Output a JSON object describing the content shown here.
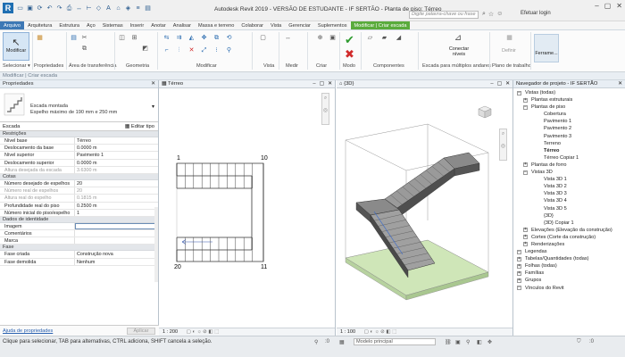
{
  "app": {
    "title": "Autodesk Revit 2019 - VERSÃO DE ESTUDANTE - IF SERTÃO - Planta de piso: Térreo",
    "logo": "R",
    "search_placeholder": "Digite palavra-chave ou frase",
    "user": "Efetuar login",
    "qat_icons": [
      "open-icon",
      "save-icon",
      "sync-icon",
      "undo-icon",
      "redo-icon",
      "print-icon",
      "measure-icon",
      "dimension-icon",
      "tag-icon",
      "text-icon",
      "3d-view-icon",
      "section-icon",
      "thin-lines-icon",
      "close-hidden-icon"
    ]
  },
  "ribbon": {
    "tabs": [
      "Arquivo",
      "Arquitetura",
      "Estrutura",
      "Aço",
      "Sistemas",
      "Inserir",
      "Anotar",
      "Analisar",
      "Massa e terreno",
      "Colaborar",
      "Vista",
      "Gerenciar",
      "Suplementos",
      "Modificar | Criar escada"
    ],
    "active_tab": "Arquivo",
    "context_tab": "Modificar | Criar escada",
    "modify_label": "Modificar",
    "panels": [
      {
        "label": "Selecionar ▾"
      },
      {
        "label": "Propriedades"
      },
      {
        "label": "Área de transferência"
      },
      {
        "label": "Geometria"
      },
      {
        "label": "Modificar"
      },
      {
        "label": "Vista"
      },
      {
        "label": "Medir"
      },
      {
        "label": "Criar"
      },
      {
        "label": "Modo"
      },
      {
        "label": "Componentes"
      },
      {
        "label": "Escada para múltiplos andares"
      },
      {
        "label": "Plano de trabalho"
      }
    ],
    "connect_levels": "Conectar níveis",
    "define_label": "Definir",
    "frame_label": "Ferrame..."
  },
  "options_bar": {
    "text": "Modificar | Criar escada"
  },
  "properties": {
    "title": "Propriedades",
    "type_name_line1": "Escada montada",
    "type_name_line2": "Espelho máximo de 190 mm e 250 mm",
    "family": "Escada",
    "edit_type": "Editar tipo",
    "groups": [
      {
        "name": "Restrições",
        "rows": [
          {
            "k": "Nível base",
            "v": "Térreo",
            "grey": false
          },
          {
            "k": "Deslocamento da base",
            "v": "0.0000 m",
            "grey": false
          },
          {
            "k": "Nível superior",
            "v": "Pavimento 1",
            "grey": false
          },
          {
            "k": "Deslocamento superior",
            "v": "0.0000 m",
            "grey": false
          },
          {
            "k": "Altura desejada da escada",
            "v": "3.6300 m",
            "grey": true
          }
        ]
      },
      {
        "name": "Cotas",
        "rows": [
          {
            "k": "Número desejado de espelhos",
            "v": "20",
            "grey": false
          },
          {
            "k": "Número real de espelhos",
            "v": "20",
            "grey": true
          },
          {
            "k": "Altura real do espelho",
            "v": "0.1815 m",
            "grey": true
          },
          {
            "k": "Profundidade real do piso",
            "v": "0.2500 m",
            "grey": false
          },
          {
            "k": "Número inicial do piso/espelho",
            "v": "1",
            "grey": false
          }
        ]
      },
      {
        "name": "Dados de identidade",
        "rows": [
          {
            "k": "Imagem",
            "v": "",
            "grey": false,
            "sel": true
          },
          {
            "k": "Comentários",
            "v": "",
            "grey": false
          },
          {
            "k": "Marca",
            "v": "",
            "grey": false
          }
        ]
      },
      {
        "name": "Fase",
        "rows": [
          {
            "k": "Fase criada",
            "v": "Construção nova",
            "grey": false
          },
          {
            "k": "Fase demolida",
            "v": "Nenhum",
            "grey": false
          }
        ]
      }
    ],
    "help_link": "Ajuda de propriedades",
    "apply": "Aplicar"
  },
  "plan_view": {
    "tab": "Térreo",
    "scale": "1 : 200",
    "labels": {
      "n1": "1",
      "n10": "10",
      "n11": "11",
      "n20": "20"
    }
  },
  "view3d": {
    "tab": "{3D}",
    "scale": "1 : 100"
  },
  "browser": {
    "title": "Navegador de projeto - IF SERTÃO",
    "items": [
      {
        "label": "Vistas (todas)",
        "level": 0,
        "toggle": "−"
      },
      {
        "label": "Plantas estruturais",
        "level": 1,
        "toggle": "+"
      },
      {
        "label": "Plantas de piso",
        "level": 1,
        "toggle": "−"
      },
      {
        "label": "Cobertura",
        "level": 3
      },
      {
        "label": "Pavimento 1",
        "level": 3
      },
      {
        "label": "Pavimento 2",
        "level": 3
      },
      {
        "label": "Pavimento 3",
        "level": 3
      },
      {
        "label": "Terreno",
        "level": 3
      },
      {
        "label": "Térreo",
        "level": 3,
        "bold": true
      },
      {
        "label": "Térreo Copiar 1",
        "level": 3
      },
      {
        "label": "Plantas de forro",
        "level": 1,
        "toggle": "+"
      },
      {
        "label": "Vistas 3D",
        "level": 1,
        "toggle": "−"
      },
      {
        "label": "Vista 3D 1",
        "level": 3
      },
      {
        "label": "Vista 3D 2",
        "level": 3
      },
      {
        "label": "Vista 3D 3",
        "level": 3
      },
      {
        "label": "Vista 3D 4",
        "level": 3
      },
      {
        "label": "Vista 3D 5",
        "level": 3
      },
      {
        "label": "{3D}",
        "level": 3
      },
      {
        "label": "{3D} Copiar 1",
        "level": 3
      },
      {
        "label": "Elevações (Elevação da construção)",
        "level": 1,
        "toggle": "+"
      },
      {
        "label": "Cortes (Corte da construção)",
        "level": 1,
        "toggle": "+"
      },
      {
        "label": "Renderizações",
        "level": 1,
        "toggle": "+"
      },
      {
        "label": "Legendas",
        "level": 0,
        "toggle": "−"
      },
      {
        "label": "Tabelas/Quantidades (todas)",
        "level": 0,
        "toggle": "+"
      },
      {
        "label": "Folhas (todas)",
        "level": 0,
        "toggle": "+"
      },
      {
        "label": "Famílias",
        "level": 0,
        "toggle": "+"
      },
      {
        "label": "Grupos",
        "level": 0,
        "toggle": "+"
      },
      {
        "label": "Vínculos do Revit",
        "level": 0,
        "toggle": "−"
      }
    ]
  },
  "status": {
    "text": "Clique para selecionar, TAB para alternativas, CTRL adiciona, SHIFT cancela a seleção.",
    "model": "Modelo principal",
    "zero": ":0"
  },
  "colors": {
    "accent": "#3d78b5",
    "context": "#5aab3c",
    "stair": "#5a5a5a",
    "floor": "#cfe6b8"
  }
}
